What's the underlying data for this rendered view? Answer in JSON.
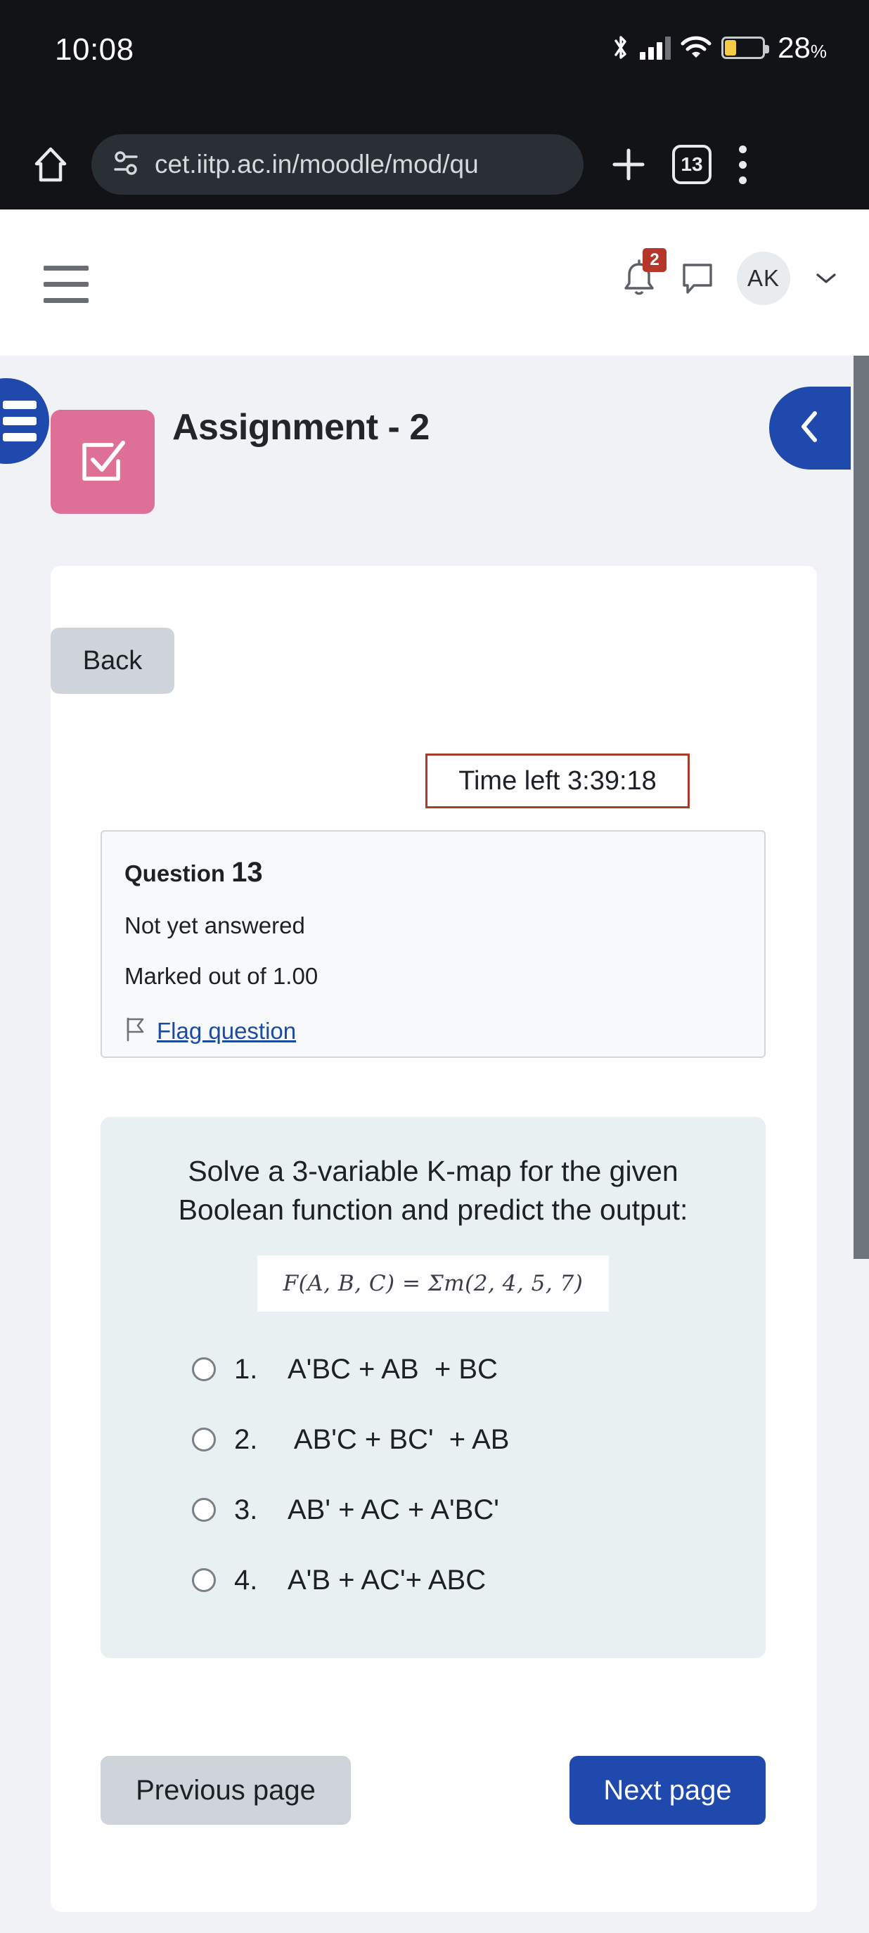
{
  "statusbar": {
    "time": "10:08",
    "battery_percent": "28",
    "percent_unit": "%",
    "icons": [
      "bluetooth-icon",
      "cellular-signal-icon",
      "wifi-icon",
      "battery-icon"
    ]
  },
  "browser": {
    "home_icon": "home-icon",
    "site_settings_icon": "site-settings-icon",
    "url": "cet.iitp.ac.in/moodle/mod/qu",
    "new_tab_icon": "plus-icon",
    "tab_count": "13",
    "overflow_icon": "more-vertical-icon"
  },
  "header": {
    "menu_icon": "hamburger-menu-icon",
    "notifications_icon": "bell-icon",
    "notifications_badge": "2",
    "messages_icon": "message-bubble-icon",
    "avatar_initials": "AK",
    "dropdown_icon": "chevron-down-icon"
  },
  "course": {
    "drawer_icon": "list-drawer-icon",
    "activity_icon": "quiz-checkbox-icon",
    "title": "Assignment - 2",
    "right_drawer_icon": "chevron-left-icon"
  },
  "quiz": {
    "back_label": "Back",
    "timer_label": "Time left 3:39:18",
    "question_word": "Question",
    "question_number": "13",
    "status": "Not yet answered",
    "marks": "Marked out of 1.00",
    "flag_icon": "flag-icon",
    "flag_label": "Flag question",
    "question_text": "Solve a 3-variable K-map for the given Boolean function and predict the output:",
    "formula": "F(A, B, C) = Σm(2, 4, 5, 7)",
    "options": [
      {
        "num": "1.",
        "text": "A'BC + AB  + BC"
      },
      {
        "num": "2.",
        "text": " AB'C + BC'  + AB"
      },
      {
        "num": "3.",
        "text": "AB' + AC + A'BC'"
      },
      {
        "num": "4.",
        "text": "A'B + AC'+ ABC"
      }
    ],
    "previous_label": "Previous page",
    "next_label": "Next page"
  },
  "colors": {
    "brand_blue": "#1f49ac",
    "activity_pink": "#de7098",
    "timer_border": "#a83b2c",
    "badge_red": "#b5362b",
    "question_bg": "#e8f0f2",
    "page_bg": "#f1f2f6"
  }
}
